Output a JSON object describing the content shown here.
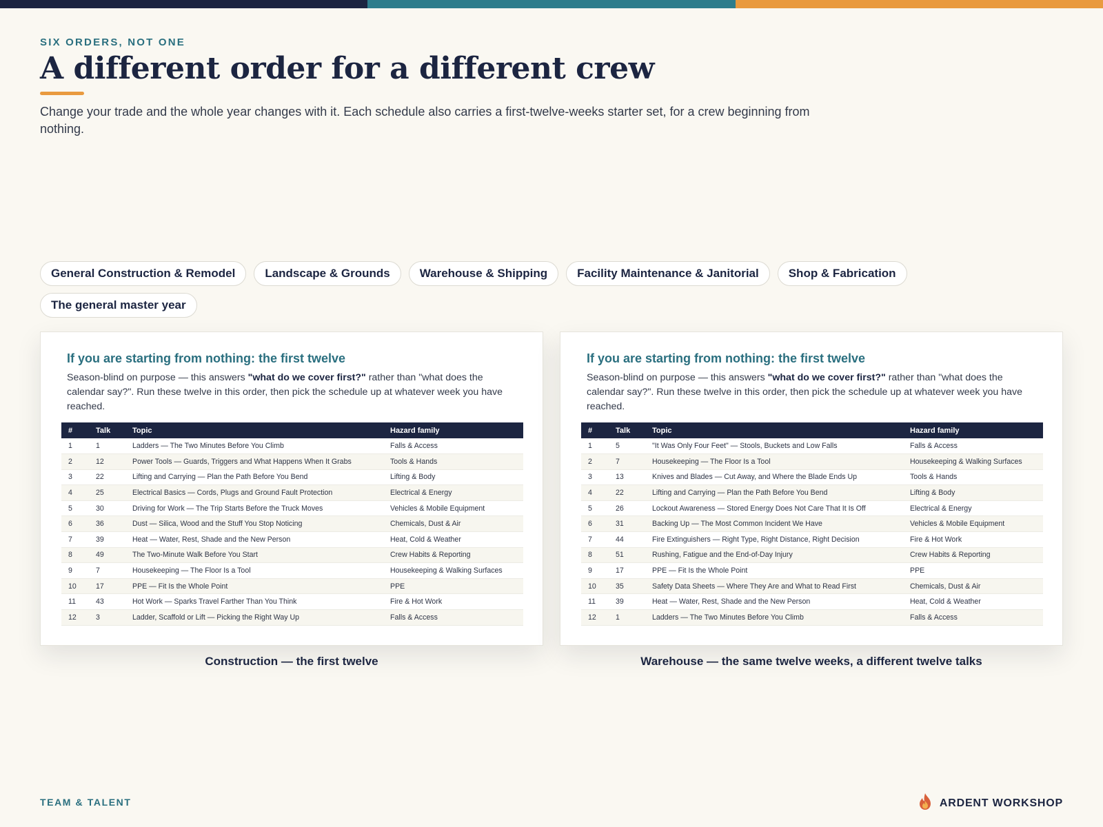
{
  "colors": {
    "navy": "#1c2541",
    "teal": "#2e7d8c",
    "orange": "#e99a3f"
  },
  "header": {
    "eyebrow": "SIX ORDERS, NOT ONE",
    "title": "A different order for a different crew",
    "lede": "Change your trade and the whole year changes with it. Each schedule also carries a first-twelve-weeks starter set, for a crew beginning from nothing."
  },
  "trades": [
    "General Construction & Remodel",
    "Landscape & Grounds",
    "Warehouse & Shipping",
    "Facility Maintenance & Janitorial",
    "Shop & Fabrication",
    "The general master year"
  ],
  "panels": {
    "left": {
      "heading": "If you are starting from nothing: the first twelve",
      "desc_a": "Season-blind on purpose — this answers ",
      "desc_bold": "\"what do we cover first?\"",
      "desc_b": " rather than \"what does the calendar say?\". Run these twelve in this order, then pick the schedule up at whatever week you have reached.",
      "caption": "Construction — the first twelve"
    },
    "right": {
      "heading": "If you are starting from nothing: the first twelve",
      "desc_a": "Season-blind on purpose — this answers ",
      "desc_bold": "\"what do we cover first?\"",
      "desc_b": " rather than \"what does the calendar say?\". Run these twelve in this order, then pick the schedule up at whatever week you have reached.",
      "caption": "Warehouse — the same twelve weeks, a different twelve talks"
    }
  },
  "table_headers": [
    "#",
    "Talk",
    "Topic",
    "Hazard family"
  ],
  "tables": {
    "left": [
      [
        "1",
        "1",
        "Ladders — The Two Minutes Before You Climb",
        "Falls & Access"
      ],
      [
        "2",
        "12",
        "Power Tools — Guards, Triggers and What Happens When It Grabs",
        "Tools & Hands"
      ],
      [
        "3",
        "22",
        "Lifting and Carrying — Plan the Path Before You Bend",
        "Lifting & Body"
      ],
      [
        "4",
        "25",
        "Electrical Basics — Cords, Plugs and Ground Fault Protection",
        "Electrical & Energy"
      ],
      [
        "5",
        "30",
        "Driving for Work — The Trip Starts Before the Truck Moves",
        "Vehicles & Mobile Equipment"
      ],
      [
        "6",
        "36",
        "Dust — Silica, Wood and the Stuff You Stop Noticing",
        "Chemicals, Dust & Air"
      ],
      [
        "7",
        "39",
        "Heat — Water, Rest, Shade and the New Person",
        "Heat, Cold & Weather"
      ],
      [
        "8",
        "49",
        "The Two-Minute Walk Before You Start",
        "Crew Habits & Reporting"
      ],
      [
        "9",
        "7",
        "Housekeeping — The Floor Is a Tool",
        "Housekeeping & Walking Surfaces"
      ],
      [
        "10",
        "17",
        "PPE — Fit Is the Whole Point",
        "PPE"
      ],
      [
        "11",
        "43",
        "Hot Work — Sparks Travel Farther Than You Think",
        "Fire & Hot Work"
      ],
      [
        "12",
        "3",
        "Ladder, Scaffold or Lift — Picking the Right Way Up",
        "Falls & Access"
      ]
    ],
    "right": [
      [
        "1",
        "5",
        "\"It Was Only Four Feet\" — Stools, Buckets and Low Falls",
        "Falls & Access"
      ],
      [
        "2",
        "7",
        "Housekeeping — The Floor Is a Tool",
        "Housekeeping & Walking Surfaces"
      ],
      [
        "3",
        "13",
        "Knives and Blades — Cut Away, and Where the Blade Ends Up",
        "Tools & Hands"
      ],
      [
        "4",
        "22",
        "Lifting and Carrying — Plan the Path Before You Bend",
        "Lifting & Body"
      ],
      [
        "5",
        "26",
        "Lockout Awareness — Stored Energy Does Not Care That It Is Off",
        "Electrical & Energy"
      ],
      [
        "6",
        "31",
        "Backing Up — The Most Common Incident We Have",
        "Vehicles & Mobile Equipment"
      ],
      [
        "7",
        "44",
        "Fire Extinguishers — Right Type, Right Distance, Right Decision",
        "Fire & Hot Work"
      ],
      [
        "8",
        "51",
        "Rushing, Fatigue and the End-of-Day Injury",
        "Crew Habits & Reporting"
      ],
      [
        "9",
        "17",
        "PPE — Fit Is the Whole Point",
        "PPE"
      ],
      [
        "10",
        "35",
        "Safety Data Sheets — Where They Are and What to Read First",
        "Chemicals, Dust & Air"
      ],
      [
        "11",
        "39",
        "Heat — Water, Rest, Shade and the New Person",
        "Heat, Cold & Weather"
      ],
      [
        "12",
        "1",
        "Ladders — The Two Minutes Before You Climb",
        "Falls & Access"
      ]
    ]
  },
  "footer": {
    "left": "TEAM & TALENT",
    "brand": "ARDENT WORKSHOP",
    "brand_icon": "flame-icon"
  }
}
